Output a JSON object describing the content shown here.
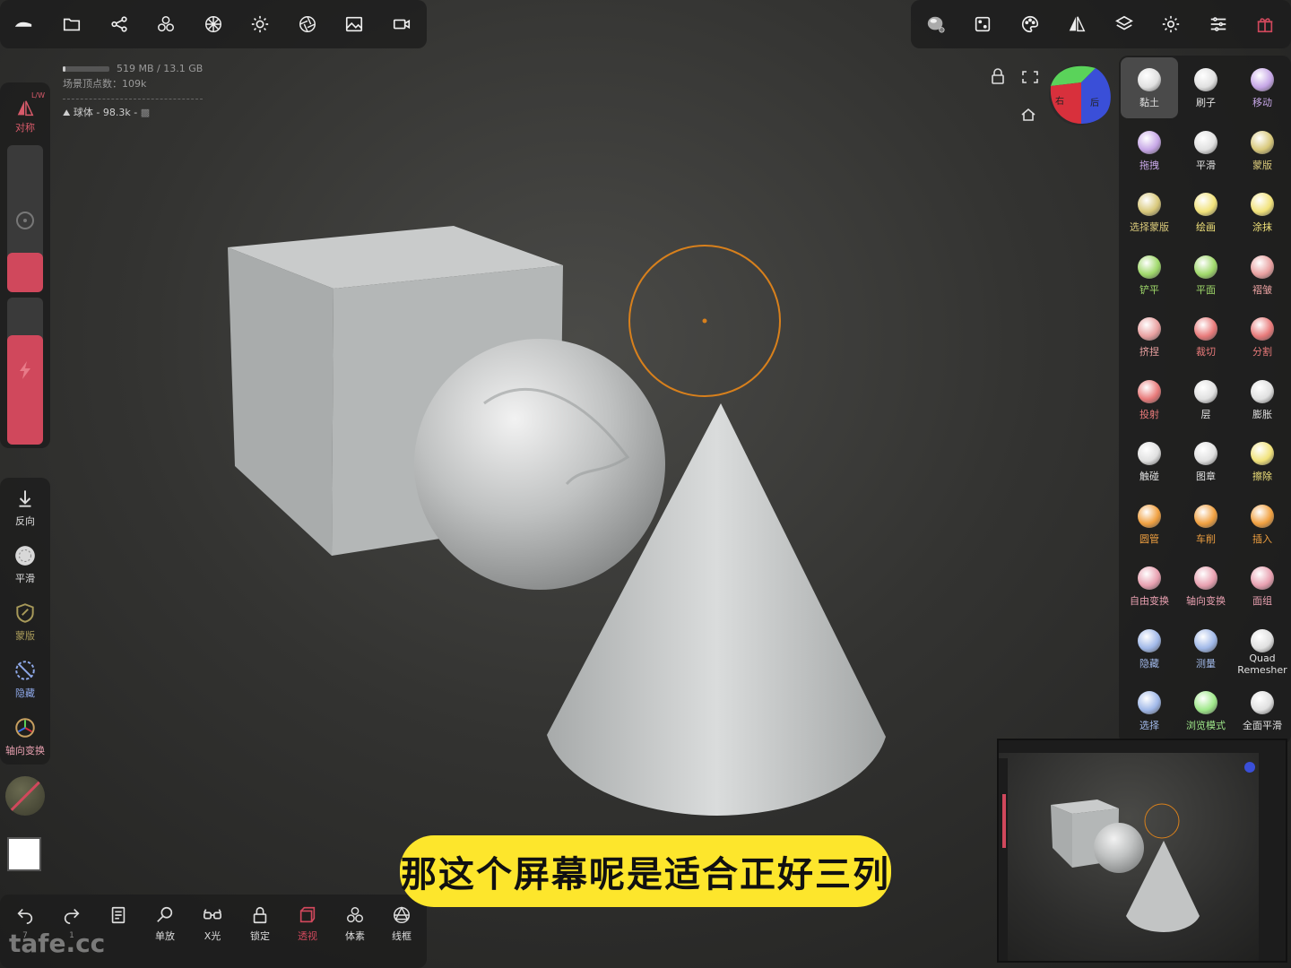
{
  "top_left_toolbar": {
    "items": [
      "menu-logo-icon",
      "folder-icon",
      "share-icon",
      "scene-objects-icon",
      "material-grid-icon",
      "light-sun-icon",
      "camera-aperture-icon",
      "image-background-icon",
      "video-camera-icon"
    ]
  },
  "top_right_toolbar": {
    "items": [
      "material-sphere-icon",
      "dice-random-icon",
      "palette-icon",
      "symmetry-triangle-icon",
      "layers-icon",
      "settings-gear-icon",
      "sliders-icon",
      "gift-icon"
    ]
  },
  "scene_info": {
    "memory": "519 MB / 13.1 GB",
    "memory_fraction": 0.04,
    "vertices": "场景顶点数：109k",
    "object": "球体 - 98.3k -"
  },
  "viewport": {
    "lock_icon": "lock-icon",
    "fullscreen_icon": "expand-icon",
    "home_icon": "home-icon",
    "gizmo_labels": {
      "right": "右",
      "back": "后"
    },
    "brush_circle_color": "#d8801c"
  },
  "left_column": {
    "symmetry_label": "对称",
    "symmetry_badge": "L/W",
    "accent": "#d0485c"
  },
  "left_tools": [
    {
      "label": "反向",
      "icon": "arrow-down-icon"
    },
    {
      "label": "平滑",
      "icon": "smooth-sphere-icon"
    },
    {
      "label": "蒙版",
      "icon": "mask-shield-icon"
    },
    {
      "label": "隐藏",
      "icon": "hide-icon"
    },
    {
      "label": "轴向变换",
      "icon": "axis-transform-icon"
    }
  ],
  "right_tools": [
    {
      "label": "黏土",
      "color": "#e0e0e0"
    },
    {
      "label": "刷子",
      "color": "#e0e0e0"
    },
    {
      "label": "移动",
      "color": "#c6a6e6"
    },
    {
      "label": "拖拽",
      "color": "#c6a6e6"
    },
    {
      "label": "平滑",
      "color": "#e0e0e0"
    },
    {
      "label": "蒙版",
      "color": "#d8c87a"
    },
    {
      "label": "选择蒙版",
      "color": "#d8c87a"
    },
    {
      "label": "绘画",
      "color": "#f1e27a"
    },
    {
      "label": "涂抹",
      "color": "#f1e27a"
    },
    {
      "label": "铲平",
      "color": "#9fd86a"
    },
    {
      "label": "平面",
      "color": "#9fd86a"
    },
    {
      "label": "褶皱",
      "color": "#e8a0a0"
    },
    {
      "label": "挤捏",
      "color": "#e8a0a0"
    },
    {
      "label": "裁切",
      "color": "#e87a7a"
    },
    {
      "label": "分割",
      "color": "#e87a7a"
    },
    {
      "label": "投射",
      "color": "#e87a7a"
    },
    {
      "label": "层",
      "color": "#e0e0e0"
    },
    {
      "label": "膨胀",
      "color": "#e0e0e0"
    },
    {
      "label": "触碰",
      "color": "#e0e0e0"
    },
    {
      "label": "图章",
      "color": "#e0e0e0"
    },
    {
      "label": "擦除",
      "color": "#f1e27a"
    },
    {
      "label": "圆管",
      "color": "#f0a040"
    },
    {
      "label": "车削",
      "color": "#f0a040"
    },
    {
      "label": "插入",
      "color": "#f0a040"
    },
    {
      "label": "自由变换",
      "color": "#e8a0b0"
    },
    {
      "label": "轴向变换",
      "color": "#e8a0b0"
    },
    {
      "label": "面组",
      "color": "#e8a0b0"
    },
    {
      "label": "隐藏",
      "color": "#a0b8e8"
    },
    {
      "label": "测量",
      "color": "#a0b8e8"
    },
    {
      "label": "Quad Remesher",
      "color": "#e0e0e0"
    },
    {
      "label": "选择",
      "color": "#a0b8e8"
    },
    {
      "label": "浏览模式",
      "color": "#9fe88a"
    },
    {
      "label": "全面平滑",
      "color": "#e0e0e0"
    }
  ],
  "bottom_toolbar": [
    {
      "label": "",
      "sub": "7",
      "icon": "undo-icon"
    },
    {
      "label": "",
      "sub": "1",
      "icon": "redo-icon"
    },
    {
      "label": "",
      "sub": "",
      "icon": "notes-icon"
    },
    {
      "label": "单放",
      "sub": "",
      "icon": "zoom-icon"
    },
    {
      "label": "X光",
      "sub": "",
      "icon": "xray-glasses-icon"
    },
    {
      "label": "锁定",
      "sub": "",
      "icon": "lock-icon"
    },
    {
      "label": "透视",
      "sub": "",
      "icon": "perspective-cube-icon"
    },
    {
      "label": "体素",
      "sub": "",
      "icon": "voxel-icon"
    },
    {
      "label": "线框",
      "sub": "",
      "icon": "wireframe-icon"
    }
  ],
  "subtitle": "那这个屏幕呢是适合正好三列",
  "watermark": "tafe.cc"
}
